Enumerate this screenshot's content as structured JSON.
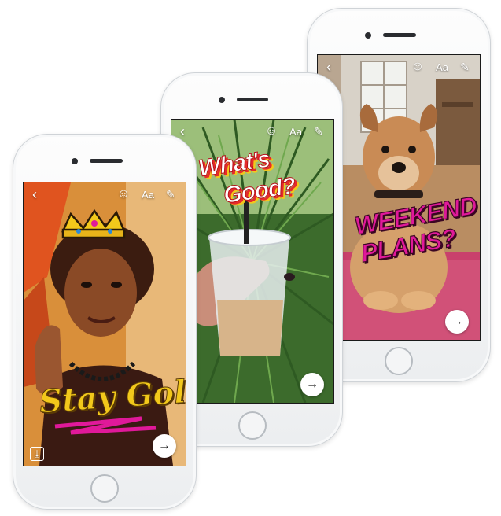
{
  "phones": [
    {
      "caption": "Stay Gold",
      "controls": {
        "back": "‹",
        "emoji": "☺",
        "text": "Aa",
        "draw": "✎",
        "save": "⤓",
        "send": "→"
      }
    },
    {
      "caption_line1": "What's",
      "caption_line2": "Good?",
      "controls": {
        "back": "‹",
        "emoji": "☺",
        "text": "Aa",
        "draw": "✎",
        "send": "→"
      }
    },
    {
      "caption_line1": "WEEKEND",
      "caption_line2": "PLANS?",
      "controls": {
        "back": "‹",
        "emoji": "☺",
        "text": "Aa",
        "draw": "✎",
        "send": "→"
      }
    }
  ],
  "colors": {
    "gold": "#f2c81b",
    "pink": "#e0199a",
    "red": "#e52b2b",
    "green": "#3c8a3a"
  }
}
